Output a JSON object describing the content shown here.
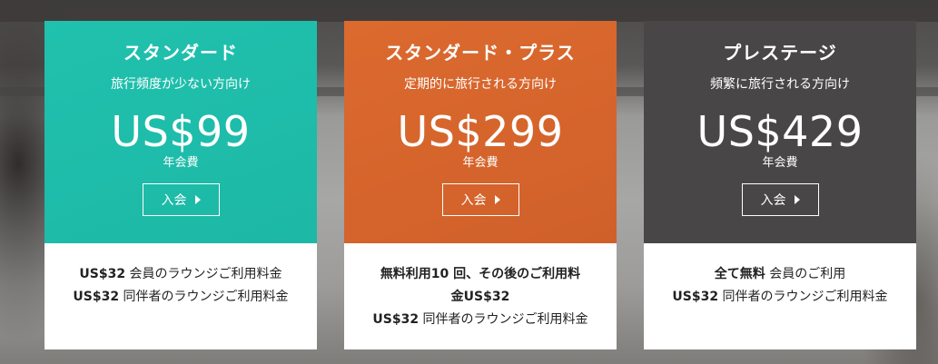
{
  "plans": [
    {
      "title": "スタンダード",
      "subtitle": "旅行頻度が少ない方向け",
      "price": "US$99",
      "fee_label": "年会費",
      "join_label": "入会",
      "benefits": [
        {
          "bold": "US$32",
          "text": " 会員のラウンジご利用料金"
        },
        {
          "bold": "US$32",
          "text": " 同伴者のラウンジご利用料金"
        }
      ],
      "accent": "#1fbeab"
    },
    {
      "title": "スタンダード・プラス",
      "subtitle": "定期的に旅行される方向け",
      "price": "US$299",
      "fee_label": "年会費",
      "join_label": "入会",
      "benefits": [
        {
          "bold": "無料利用10 回、その後のご利用料",
          "text": ""
        },
        {
          "bold": "金US$32",
          "text": ""
        },
        {
          "bold": "US$32",
          "text": " 同伴者のラウンジご利用料金"
        }
      ],
      "accent": "#d8652d"
    },
    {
      "title": "プレステージ",
      "subtitle": "頻繁に旅行される方向け",
      "price": "US$429",
      "fee_label": "年会費",
      "join_label": "入会",
      "benefits": [
        {
          "bold": "全て無料",
          "text": " 会員のご利用"
        },
        {
          "bold": "US$32",
          "text": " 同伴者のラウンジご利用料金"
        }
      ],
      "accent": "#484646"
    }
  ]
}
